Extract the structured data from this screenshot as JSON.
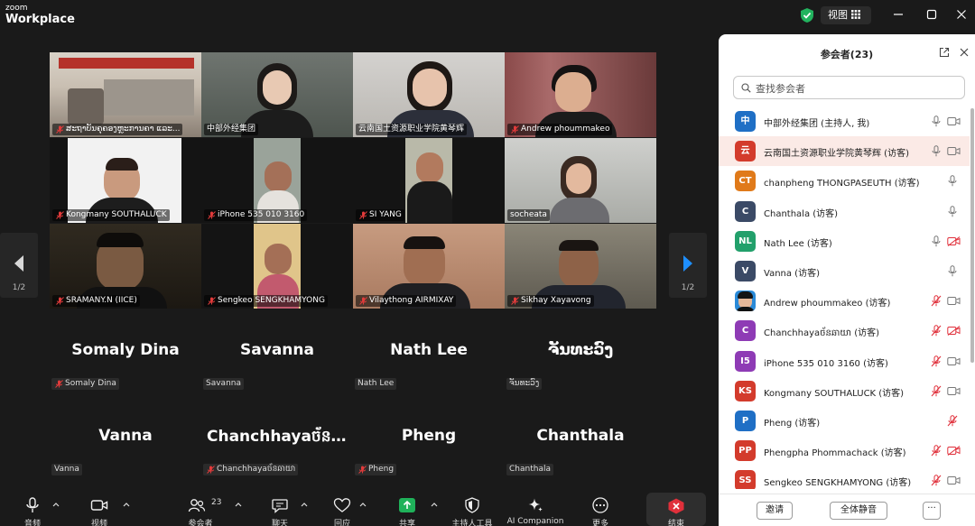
{
  "titlebar": {
    "logo_top": "zoom",
    "logo_bottom": "Workplace",
    "view_label": "视图"
  },
  "gallery": {
    "tiles": [
      {
        "name": "ສະຖາບັນຄຸຄອງຫຼະການຄາ ແລະ..."
      },
      {
        "name": "中部外经集团"
      },
      {
        "name": "云南国土资源职业学院黄琴辉"
      },
      {
        "name": "Andrew phoummakeo"
      },
      {
        "name": "Kongmany SOUTHALUCK"
      },
      {
        "name": "iPhone 535 010 3160"
      },
      {
        "name": "SI YANG"
      },
      {
        "name": "socheata"
      },
      {
        "name": "SRAMANY.N (IICE)"
      },
      {
        "name": "Sengkeo SENGKHAMYONG"
      },
      {
        "name": "Vilaythong AIRMIXAY"
      },
      {
        "name": "Sikhay Xayavong"
      }
    ],
    "name_tiles": [
      {
        "big": "Somaly Dina",
        "name": "Somaly Dina"
      },
      {
        "big": "Savanna",
        "name": "Savanna"
      },
      {
        "big": "Nath Lee",
        "name": "Nath Lee"
      },
      {
        "big": "ຈັນທະວົງ",
        "name": "ຈັນທະວົງ"
      },
      {
        "big": "Vanna",
        "name": "Vanna"
      },
      {
        "big": "Chanchhayaច័ន...",
        "name": "Chanchhayaច័នឆាយា"
      },
      {
        "big": "Pheng",
        "name": "Pheng"
      },
      {
        "big": "Chanthala",
        "name": "Chanthala"
      }
    ],
    "page_left": "1/2",
    "page_right": "1/2"
  },
  "panel": {
    "title": "参会者(23)",
    "search_placeholder": "查找参会者",
    "participants": [
      {
        "initials": "中",
        "color": "#1f6fc5",
        "name": "中部外经集团 (主持人, 我)",
        "mic": "on",
        "cam": "on"
      },
      {
        "initials": "云",
        "color": "#d33b2c",
        "name": "云南国土资源职业学院黄琴辉 (访客)",
        "mic": "on",
        "cam": "on"
      },
      {
        "initials": "CT",
        "color": "#e07a1a",
        "name": "chanpheng THONGPASEUTH (访客)",
        "mic": "on",
        "cam": "none"
      },
      {
        "initials": "C",
        "color": "#3b4a66",
        "name": "Chanthala (访客)",
        "mic": "on",
        "cam": "none"
      },
      {
        "initials": "NL",
        "color": "#22a06b",
        "name": "Nath Lee (访客)",
        "mic": "on",
        "cam": "off"
      },
      {
        "initials": "V",
        "color": "#3b4a66",
        "name": "Vanna (访客)",
        "mic": "on",
        "cam": "none"
      },
      {
        "initials": "",
        "color": "#2a8ad8",
        "name": "Andrew phoummakeo (访客)",
        "mic": "off",
        "cam": "on"
      },
      {
        "initials": "C",
        "color": "#8e3bb5",
        "name": "Chanchhayaច័នឆាយា (访客)",
        "mic": "off",
        "cam": "off"
      },
      {
        "initials": "I5",
        "color": "#8e3bb5",
        "name": "iPhone 535 010 3160 (访客)",
        "mic": "off",
        "cam": "on"
      },
      {
        "initials": "KS",
        "color": "#d33b2c",
        "name": "Kongmany SOUTHALUCK (访客)",
        "mic": "off",
        "cam": "on"
      },
      {
        "initials": "P",
        "color": "#1f6fc5",
        "name": "Pheng (访客)",
        "mic": "off",
        "cam": "none"
      },
      {
        "initials": "PP",
        "color": "#d33b2c",
        "name": "Phengpha Phommachack (访客)",
        "mic": "off",
        "cam": "off"
      },
      {
        "initials": "SS",
        "color": "#d33b2c",
        "name": "Sengkeo SENGKHAMYONG (访客)",
        "mic": "off",
        "cam": "on"
      }
    ],
    "invite_label": "邀请",
    "muteall_label": "全体静音",
    "more_label": "···"
  },
  "toolbar": {
    "audio": "音频",
    "video": "视频",
    "participants": "参会者",
    "participants_count": "23",
    "chat": "聊天",
    "react": "回应",
    "share": "共享",
    "host_tools": "主持人工具",
    "ai": "AI Companion",
    "more": "更多",
    "end": "结束"
  },
  "colors": {
    "active_speaker": "#2ec862",
    "share_green": "#1fb25a",
    "end_red": "#e0303b",
    "pager_arrow_blue": "#1e8fff"
  }
}
